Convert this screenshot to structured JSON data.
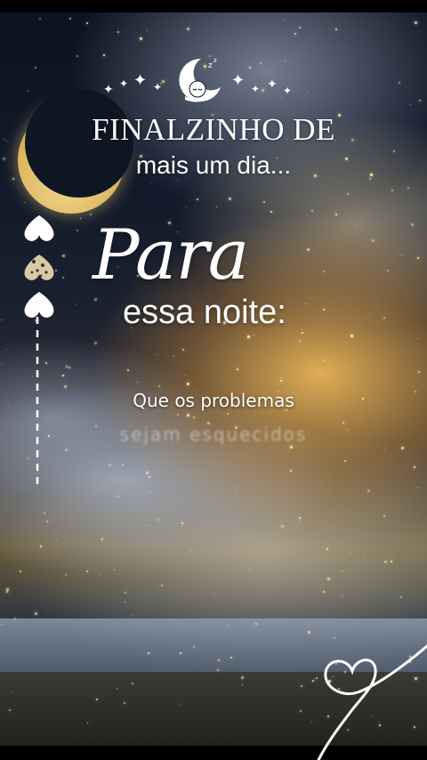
{
  "logo": {
    "icon": "sleeping-baby-on-moon-icon",
    "stars": [
      "four-point-star-icon"
    ]
  },
  "title": {
    "line1": "FINALZINHO DE",
    "line2": "mais um dia..."
  },
  "heading": {
    "script": "Para",
    "subtitle": "essa noite:"
  },
  "message": {
    "line1": "Que os problemas",
    "line2": "sejam esquecidos"
  },
  "colors": {
    "text": "#ffffff",
    "moon": "#d9b25a",
    "sky": "#0e1624",
    "glow": "#ffc45a"
  }
}
